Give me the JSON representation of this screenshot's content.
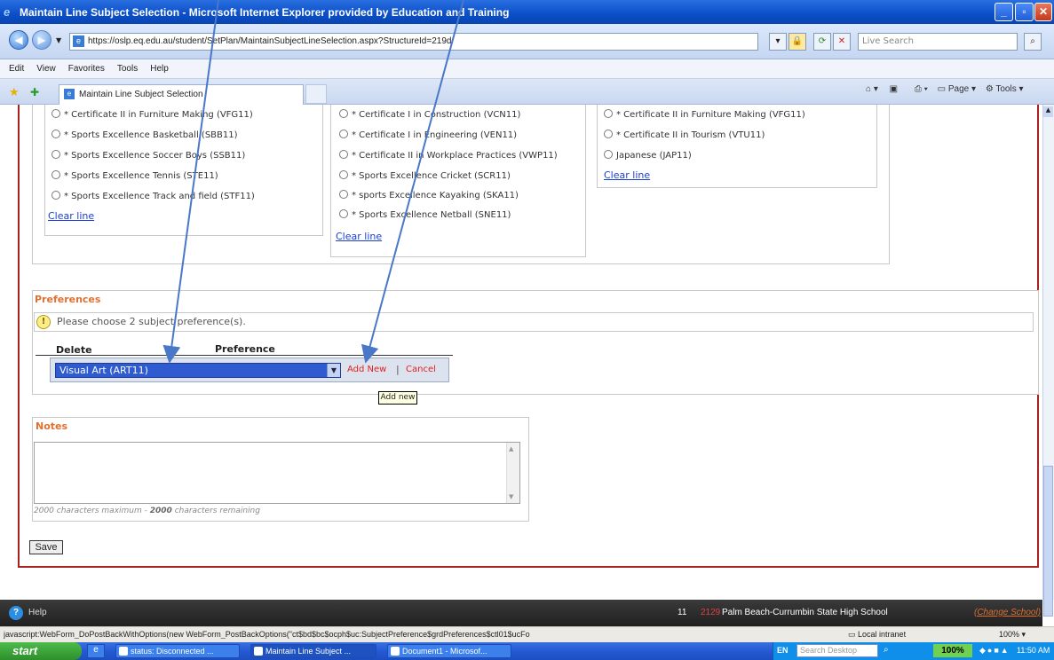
{
  "window": {
    "title": "Maintain Line Subject Selection - Microsoft Internet Explorer provided by Education and Training",
    "url": "https://oslp.eq.edu.au/student/SetPlan/MaintainSubjectLineSelection.aspx?StructureId=219d",
    "search_placeholder": "Live Search"
  },
  "menu": [
    "Edit",
    "View",
    "Favorites",
    "Tools",
    "Help"
  ],
  "tab": {
    "label": "Maintain Line Subject Selection"
  },
  "toolbar_right": {
    "page": "Page",
    "tools": "Tools"
  },
  "lines": [
    {
      "options": [
        "* Certificate II in Furniture Making (VFG11)",
        "* Sports Excellence Basketball (SBB11)",
        "* Sports Excellence Soccer Boys (SSB11)",
        "* Sports Excellence Tennis (STE11)",
        "* Sports Excellence Track and field (STF11)"
      ],
      "clear_label": "Clear line"
    },
    {
      "options": [
        "* Certificate I in Construction (VCN11)",
        "* Certificate I in Engineering (VEN11)",
        "* Certificate II in Workplace Practices (VWP11)",
        "* Sports Excellence Cricket (SCR11)",
        "* sports Excellence Kayaking (SKA11)",
        "* Sports Excellence Netball (SNE11)"
      ],
      "clear_label": "Clear line"
    },
    {
      "options": [
        "* Certificate II in Furniture Making (VFG11)",
        "* Certificate II in Tourism (VTU11)",
        "Japanese (JAP11)"
      ],
      "clear_label": "Clear line"
    }
  ],
  "preferences": {
    "heading": "Preferences",
    "info": "Please choose 2 subject preference(s).",
    "col_delete": "Delete",
    "col_preference": "Preference",
    "selected": "Visual Art (ART11)",
    "add_new": "Add New",
    "separator": "|",
    "cancel": "Cancel",
    "tooltip": "Add new"
  },
  "notes": {
    "heading": "Notes",
    "value": "",
    "max_label": "2000 characters maximum -",
    "remaining_count": "2000",
    "remaining_label": "characters remaining"
  },
  "save_label": "Save",
  "helpbar": {
    "help": "Help",
    "num1": "11",
    "num2": "2129",
    "school": "Palm Beach-Currumbin State High School",
    "change": "(Change School)"
  },
  "statusbar": {
    "text": "javascript:WebForm_DoPostBackWithOptions(new WebForm_PostBackOptions(\"ct$bd$bc$ocph$uc:SubjectPreference$grdPreferences$ctl01$ucFo",
    "zone": "Local intranet",
    "zoom": "100%"
  },
  "taskbar": {
    "start": "start",
    "items": [
      "status: Disconnected ...",
      "Maintain Line Subject ...",
      "Document1 - Microsof..."
    ],
    "lang": "EN",
    "search": "Search Desktop",
    "percent": "100%",
    "clock": "11:50 AM"
  },
  "colors": {
    "accent_orange": "#e07030",
    "border_red": "#a82222",
    "link_blue": "#1a3fd4",
    "select_blue": "#2f5bd1",
    "arrow_blue": "#4a78c8"
  }
}
